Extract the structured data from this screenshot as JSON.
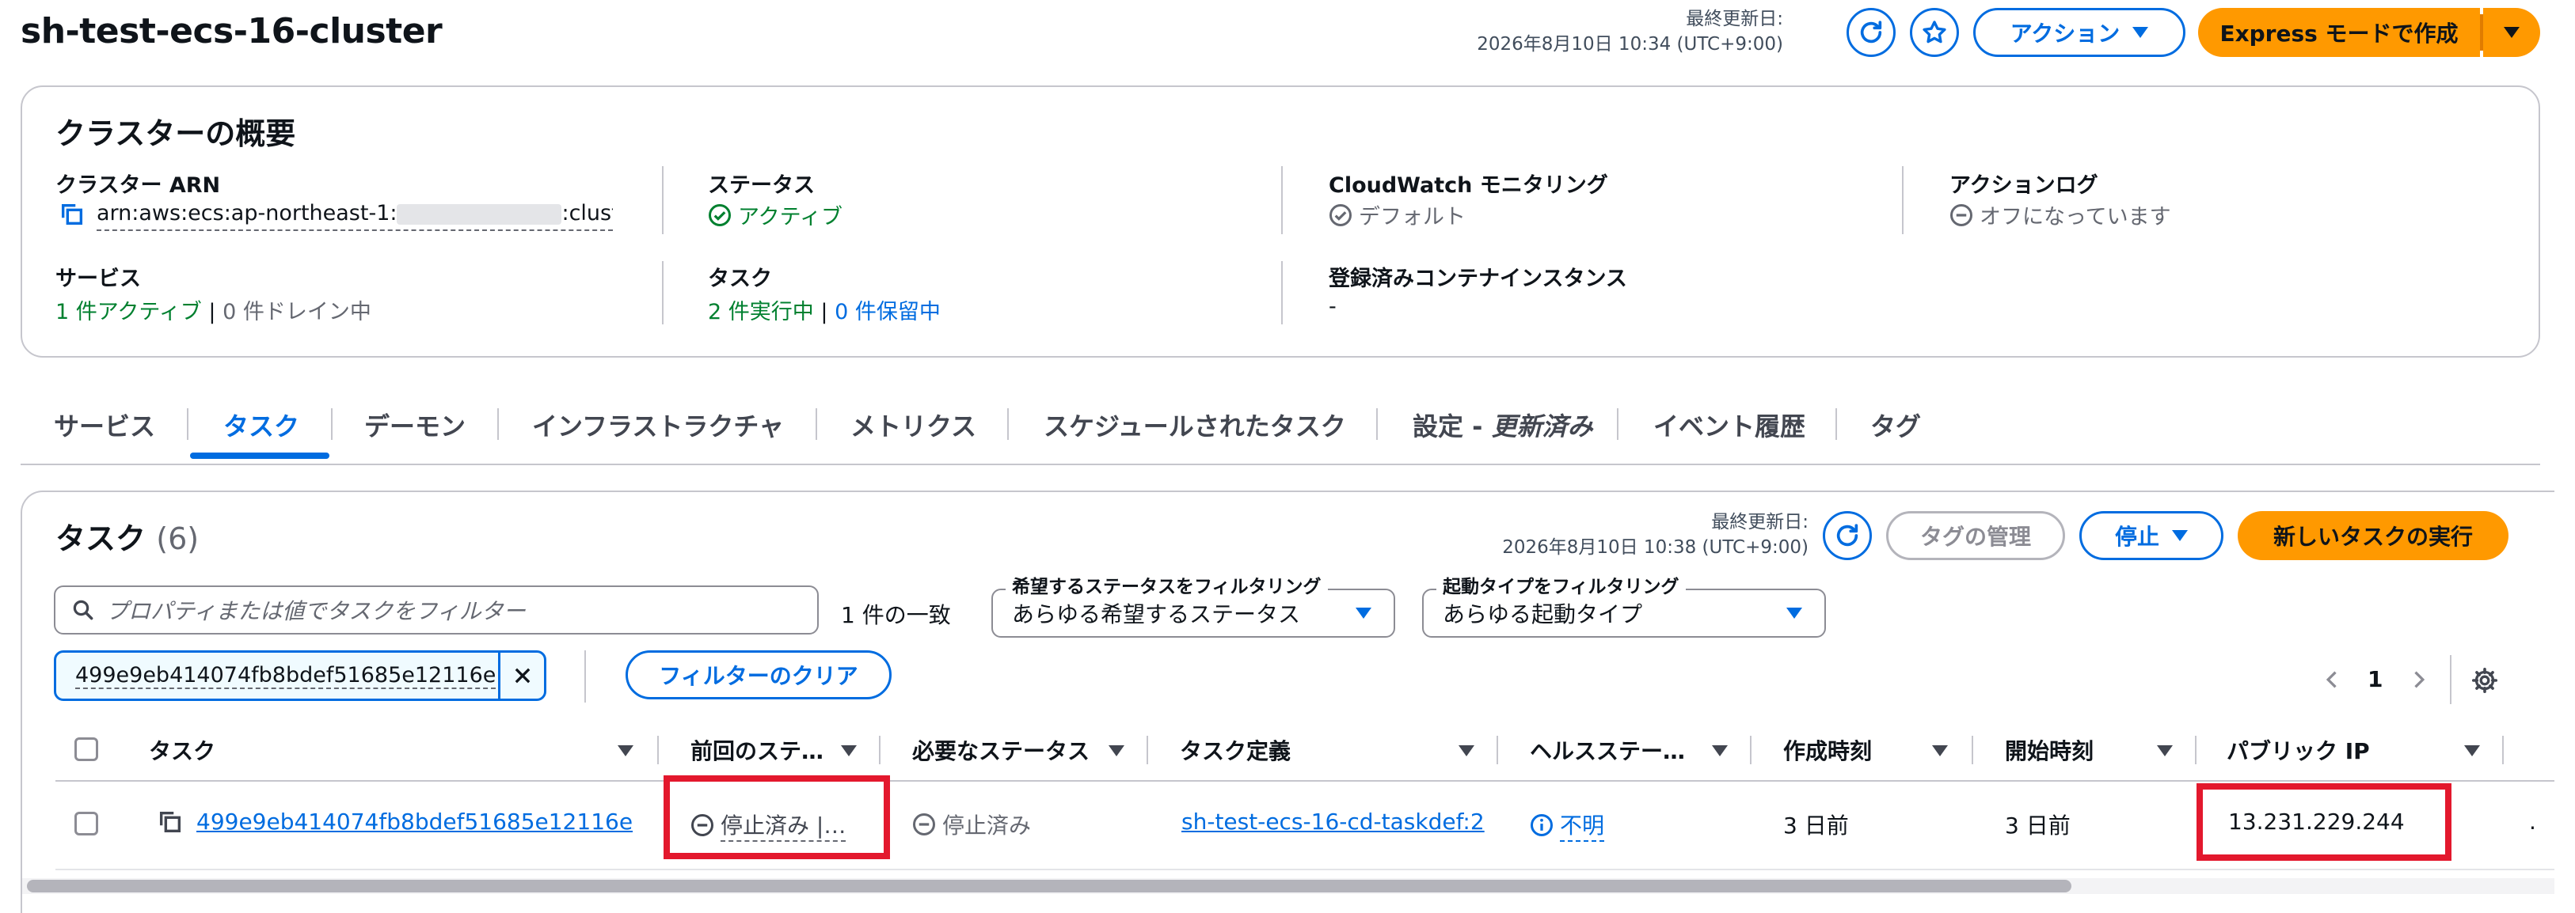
{
  "header": {
    "title": "sh-test-ecs-16-cluster",
    "updated_label": "最終更新日:",
    "updated_time": "2026年8月10日 10:34 (UTC+9:00)",
    "actions_label": "アクション",
    "express_label": "Express モードで作成"
  },
  "overview": {
    "title": "クラスターの概要",
    "arn_label": "クラスター ARN",
    "arn_value_start": "arn:aws:ecs:ap-northeast-1:",
    "arn_value_end": ":clust…",
    "status_label": "ステータス",
    "status_value": "アクティブ",
    "cloudwatch_label": "CloudWatch モニタリング",
    "cloudwatch_value": "デフォルト",
    "actionlog_label": "アクションログ",
    "actionlog_value": "オフになっています",
    "services_label": "サービス",
    "services_active": "1 件アクティブ",
    "services_sep": "|",
    "services_draining": "0 件ドレイン中",
    "tasks_label": "タスク",
    "tasks_running": "2 件実行中",
    "tasks_sep": "|",
    "tasks_pending": "0 件保留中",
    "instances_label": "登録済みコンテナインスタンス",
    "instances_value": "-"
  },
  "tabs": [
    {
      "label": "サービス"
    },
    {
      "label": "タスク"
    },
    {
      "label": "デーモン"
    },
    {
      "label": "インフラストラクチャ"
    },
    {
      "label": "メトリクス"
    },
    {
      "label": "スケジュールされたタスク"
    },
    {
      "label": "設定 - ",
      "suffix": "更新済み"
    },
    {
      "label": "イベント履歴"
    },
    {
      "label": "タグ"
    }
  ],
  "tasks_panel": {
    "title": "タスク",
    "count": "(6)",
    "updated_label": "最終更新日:",
    "updated_time": "2026年8月10日 10:38 (UTC+9:00)",
    "manage_tags_label": "タグの管理",
    "stop_label": "停止",
    "run_task_label": "新しいタスクの実行",
    "search_placeholder": "プロパティまたは値でタスクをフィルター",
    "match_count": "1 件の一致",
    "desired_filter_label": "希望するステータスをフィルタリング",
    "desired_filter_value": "あらゆる希望するステータス",
    "launch_filter_label": "起動タイプをフィルタリング",
    "launch_filter_value": "あらゆる起動タイプ",
    "token_value": "499e9eb414074fb8bdef51685e12116e",
    "clear_filter_label": "フィルターのクリア",
    "page_number": "1",
    "columns": [
      "タスク",
      "前回のステ…",
      "必要なステータス",
      "タスク定義",
      "ヘルスステー…",
      "作成時刻",
      "開始時刻",
      "パブリック IP"
    ],
    "row": {
      "task_id": "499e9eb414074fb8bdef51685e12116e",
      "last_status": "停止済み |…",
      "desired_status": "停止済み",
      "task_definition": "sh-test-ecs-16-cd-taskdef:2",
      "health": "不明",
      "created": "3 日前",
      "started": "3 日前",
      "public_ip": "13.231.229.244"
    }
  },
  "colors": {
    "accent": "#006ce0",
    "primary_button": "#ff9900",
    "success": "#00802f",
    "highlight_box": "#e3182d"
  }
}
